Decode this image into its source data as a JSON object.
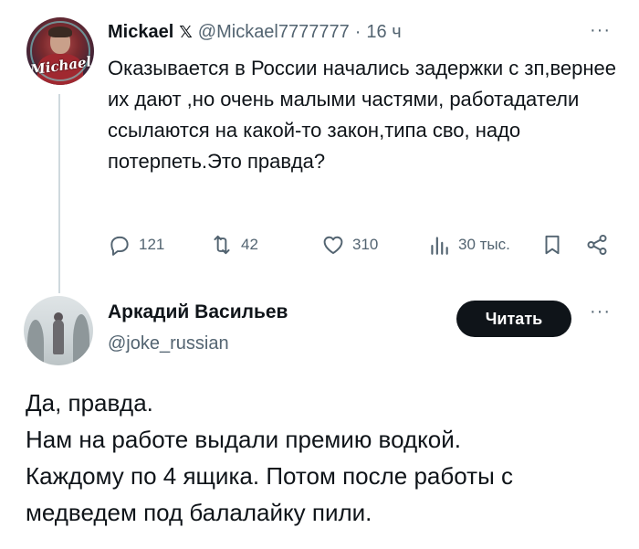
{
  "tweet": {
    "author_name": "Mickael",
    "badge": "𝕏",
    "handle": "@Mickael7777777",
    "separator": "·",
    "time": "16 ч",
    "more": "···",
    "avatar_signature": "Michael",
    "text": "Оказывается в России начались задержки с зп,вернее их дают ,но очень малыми частями, работадатели ссылаются на какой-то закон,типа сво, надо потерпеть.Это правда?",
    "replies": "121",
    "reposts": "42",
    "likes": "310",
    "views": "30 тыс."
  },
  "reply": {
    "author_name": "Аркадий Васильев",
    "handle": "@joke_russian",
    "follow_label": "Читать",
    "more": "···",
    "text": "Да, правда.\nНам на работе выдали премию водкой.\nКаждому по 4 ящика. Потом после работы с медведем под балалайку пили."
  },
  "icons": {
    "reply": "reply-icon",
    "repost": "repost-icon",
    "like": "heart-icon",
    "views": "views-icon",
    "bookmark": "bookmark-icon",
    "share": "share-icon"
  },
  "colors": {
    "text": "#0f1419",
    "secondary": "#536471",
    "thread_line": "#cfd9de",
    "button_bg": "#0f1419"
  }
}
